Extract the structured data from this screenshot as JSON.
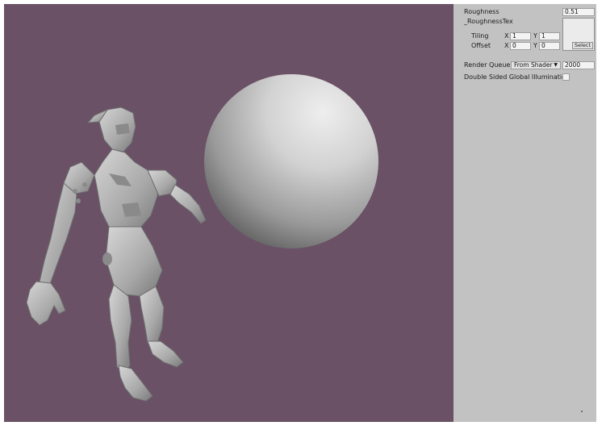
{
  "inspector": {
    "roughness": {
      "label": "Roughness",
      "value": "0.51"
    },
    "roughness_tex": {
      "label": "_RoughnessTex",
      "select_label": "Select",
      "tiling": {
        "label": "Tiling",
        "x_label": "X",
        "x": "1",
        "y_label": "Y",
        "y": "1"
      },
      "offset": {
        "label": "Offset",
        "x_label": "X",
        "x": "0",
        "y_label": "Y",
        "y": "0"
      }
    },
    "render_queue": {
      "label": "Render Queue",
      "option": "From Shader",
      "value": "2000"
    },
    "double_sided_gi": {
      "label": "Double Sided Global Illumination",
      "checked": false
    }
  },
  "viewport": {
    "background": "#6a5166",
    "objects": [
      "sphere",
      "armored-character-model"
    ]
  },
  "colors": {
    "inspector_bg": "#c2c2c2",
    "field_bg": "#f3f3f3"
  }
}
